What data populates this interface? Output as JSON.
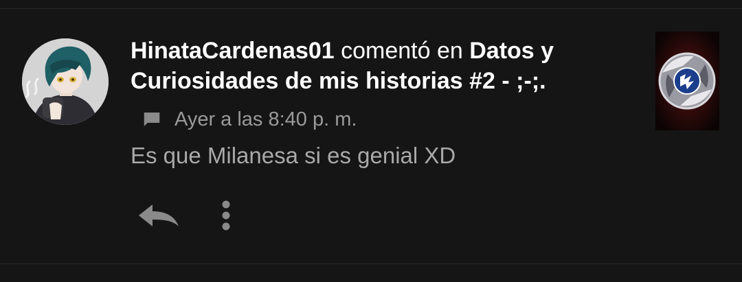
{
  "notification": {
    "username": "HinataCardenas01",
    "action_text": " comentó en ",
    "story_title": "Datos y Curiosidades de mis historias #2 - ;-;.",
    "timestamp": "Ayer a las 8:40 p. m.",
    "comment_text": "Es que Milanesa si es genial XD"
  },
  "icons": {
    "comment": "comment-icon",
    "reply": "reply-icon",
    "more": "more-vertical-icon"
  },
  "colors": {
    "background": "#151515",
    "title_text": "#ffffff",
    "meta_text": "#9a9a9a",
    "body_text": "#a9a9a9",
    "icon_gray": "#8a8a8a"
  }
}
